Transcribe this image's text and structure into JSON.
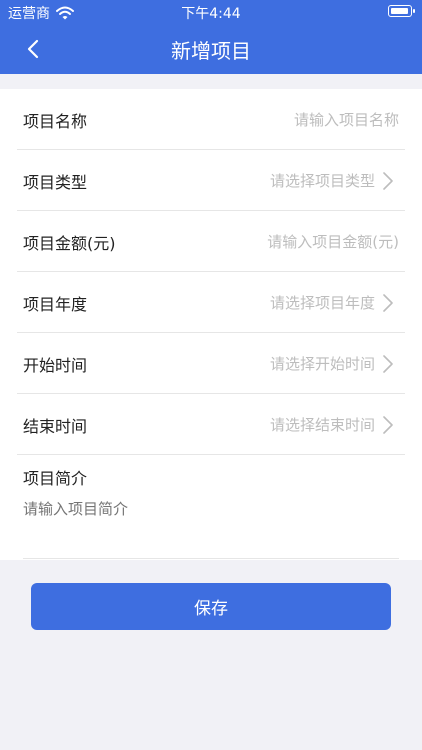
{
  "status_bar": {
    "carrier": "运营商",
    "time": "下午4:44"
  },
  "nav": {
    "title": "新增项目",
    "back_icon": "chevron-left-icon"
  },
  "form": {
    "rows": [
      {
        "label": "项目名称",
        "placeholder": "请输入项目名称",
        "type": "input"
      },
      {
        "label": "项目类型",
        "placeholder": "请选择项目类型",
        "type": "select"
      },
      {
        "label": "项目金额(元)",
        "placeholder": "请输入项目金额(元)",
        "type": "input"
      },
      {
        "label": "项目年度",
        "placeholder": "请选择项目年度",
        "type": "select"
      },
      {
        "label": "开始时间",
        "placeholder": "请选择开始时间",
        "type": "select"
      },
      {
        "label": "结束时间",
        "placeholder": "请选择结束时间",
        "type": "select"
      }
    ],
    "intro": {
      "label": "项目简介",
      "placeholder": "请输入项目简介"
    }
  },
  "save_label": "保存",
  "colors": {
    "primary": "#3e6ee0",
    "background": "#f1f1f6",
    "placeholder": "#bdbdbd",
    "divider": "#e6e6e6"
  }
}
